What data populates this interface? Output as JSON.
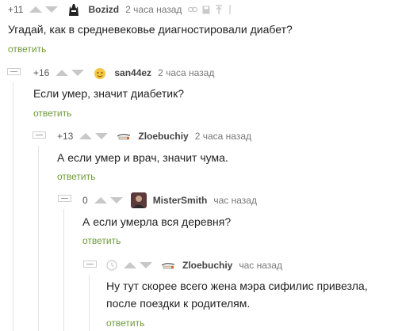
{
  "comments": [
    {
      "rating": "+11",
      "user": "Bozizd",
      "time": "2 часа назад",
      "text_lines": [
        "Угадай, как в средневековье диагностировали диабет?"
      ],
      "reply": "ответить",
      "avatar_icon": "batman-avatar-icon",
      "tools": [
        "link-icon",
        "save-icon",
        "reply-to-parent-icon",
        "more-icon"
      ]
    },
    {
      "rating": "+16",
      "user": "san44ez",
      "time": "2 часа назад",
      "text_lines": [
        "Если умер, значит диабетик?"
      ],
      "reply": "ответить",
      "avatar_icon": "emoji-avatar-icon"
    },
    {
      "rating": "+13",
      "user": "Zloebuchiy",
      "time": "2 часа назад",
      "text_lines": [
        "А если умер и врач, значит чума."
      ],
      "reply": "ответить",
      "avatar_icon": "cigarette-avatar-icon"
    },
    {
      "rating": "0",
      "user": "MisterSmith",
      "time": "час назад",
      "text_lines": [
        "А если умерла вся деревня?"
      ],
      "reply": "ответить",
      "avatar_icon": "photo-avatar-icon"
    },
    {
      "rating": "",
      "user": "Zloebuchiy",
      "time": "час назад",
      "text_lines": [
        "Ну тут скорее всего жена мэра сифилис привезла,",
        "после поездки к родителям."
      ],
      "reply": "ответить",
      "avatar_icon": "cigarette-avatar-icon",
      "rating_icon": "clock-icon"
    }
  ],
  "colors": {
    "reply": "#6d9a3a",
    "arrow": "#c8c8c8",
    "thread_line": "#e3e3e3"
  }
}
